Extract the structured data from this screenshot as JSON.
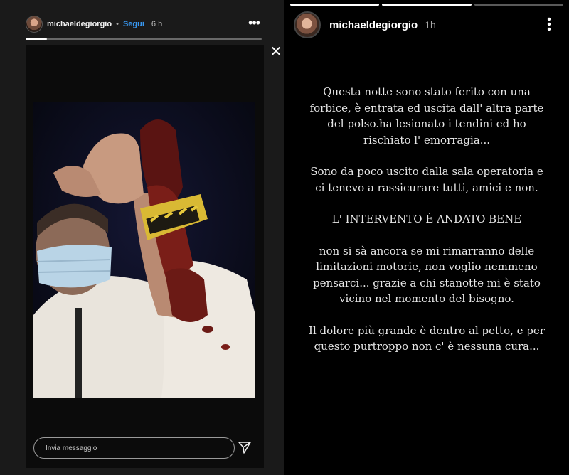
{
  "left_story": {
    "username": "michaeldegiorgio",
    "separator": "•",
    "follow_label": "Segui",
    "time": "6 h",
    "progress": 0.09,
    "more_icon": "more-horizontal-icon",
    "close_icon": "close-icon",
    "reply_placeholder": "Invia messaggio",
    "send_icon": "send-icon"
  },
  "right_story": {
    "username": "michaeldegiorgio",
    "time": "1h",
    "progress_segments": [
      "full",
      "full",
      "empty"
    ],
    "more_icon": "more-vertical-icon",
    "paragraphs": [
      "Questa notte sono stato ferito con una forbice, è entrata ed uscita dall' altra parte del polso.ha lesionato i tendini ed ho rischiato l' emorragia...",
      "Sono da poco uscito dalla sala operatoria e ci tenevo a rassicurare tutti, amici e non.",
      "L' INTERVENTO È ANDATO BENE",
      "non si sà ancora se mi rimarranno delle limitazioni motorie, non voglio nemmeno pensarci... grazie a chi stanotte mi è stato vicino nel momento del bisogno.",
      "Il dolore più grande è dentro al petto, e per questo purtroppo non c' è nessuna cura..."
    ]
  },
  "colors": {
    "follow_blue": "#3897f0",
    "left_background": "#1a1a1a",
    "right_background": "#000000"
  }
}
